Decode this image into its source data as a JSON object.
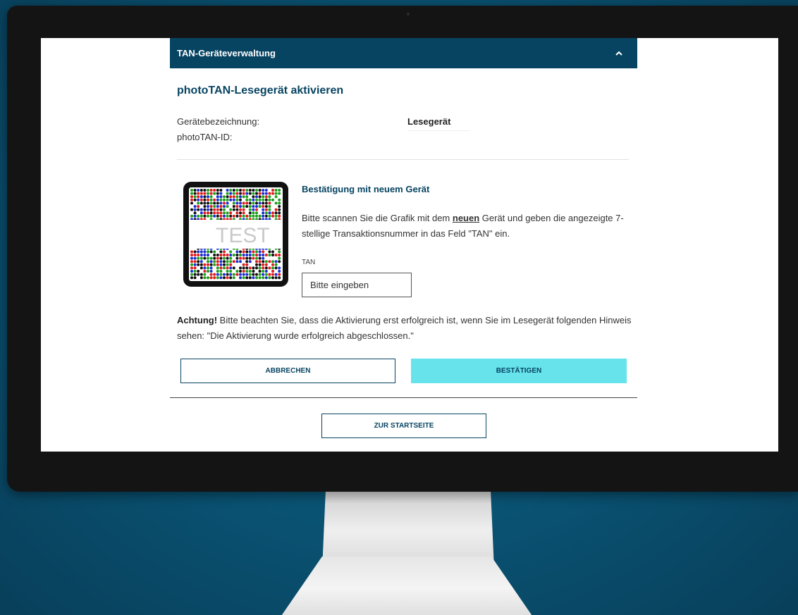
{
  "panel": {
    "title": "TAN-Geräteverwaltung",
    "collapse_icon": "chevron-up-icon"
  },
  "section": {
    "title": "photoTAN-Lesegerät aktivieren"
  },
  "device_info": {
    "name_label": "Gerätebezeichnung:",
    "name_value": "Lesegerät",
    "id_label": "photoTAN-ID:"
  },
  "confirmation": {
    "title": "Bestätigung mit neuem Gerät",
    "instruction_pre": "Bitte scannen Sie die Grafik mit dem ",
    "instruction_emphasis": "neuen",
    "instruction_post": " Gerät und geben die angezeigte 7-stellige Transaktionsnummer in das Feld \"TAN\" ein.",
    "tan_label": "TAN",
    "tan_placeholder": "Bitte eingeben",
    "tan_value": ""
  },
  "phototan_image": {
    "overlay_text": "TEST",
    "dot_colors": [
      "#e01b1b",
      "#1d9e1d",
      "#1b2ed1",
      "#111111"
    ]
  },
  "warning": {
    "label": "Achtung!",
    "text": " Bitte beachten Sie, dass die Aktivierung erst erfolgreich ist, wenn Sie im Lesegerät folgenden Hinweis sehen: \"Die Aktivierung wurde erfolgreich abgeschlossen.\""
  },
  "buttons": {
    "cancel": "ABBRECHEN",
    "confirm": "BESTÄTIGEN",
    "home": "ZUR STARTSEITE"
  },
  "colors": {
    "primary": "#074462",
    "accent": "#67e3ec",
    "background": "#0a5576"
  }
}
